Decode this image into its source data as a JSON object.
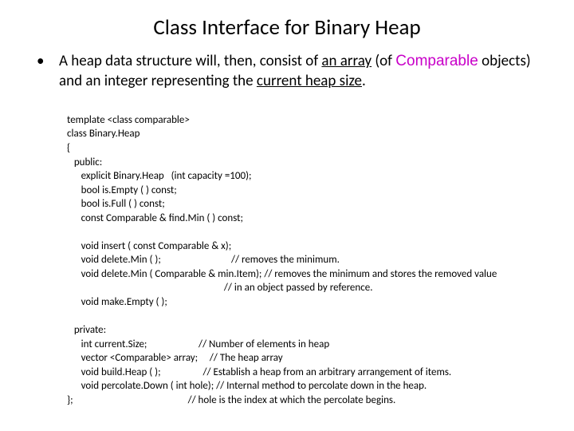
{
  "title": "Class Interface for Binary Heap",
  "bullet": {
    "dot": "•",
    "pre": "A heap data structure will, then, consist of ",
    "underlined1": "an array",
    "mid1": " (of ",
    "comparable": "Comparable",
    "mid2": " objects) and an integer representing the ",
    "underlined2": "current heap size",
    "post": "."
  },
  "code": {
    "l01": "template <class comparable>",
    "l02": "class Binary.Heap",
    "l03": "{",
    "l04": "   public:",
    "l05": "      explicit Binary.Heap   (int capacity =100);",
    "l06": "      bool is.Empty ( ) const;",
    "l07": "      bool is.Full ( ) const;",
    "l08": "      const Comparable & find.Min ( ) const;",
    "l09": "",
    "l10": "      void insert ( const Comparable & x);",
    "l11": "      void delete.Min ( );                              // removes the minimum.",
    "l12": "      void delete.Min ( Comparable & min.Item); // removes the minimum and stores the removed value",
    "l13": "                                                                   // in an object passed by reference.",
    "l14": "      void make.Empty ( );",
    "l15": "",
    "l16": "   private:",
    "l17": "      int current.Size;                      // Number of elements in heap",
    "l18": "      vector <Comparable> array;     // The heap array",
    "l19": "      void build.Heap ( );                  // Establish a heap from an arbitrary arrangement of items.",
    "l20": "      void percolate.Down ( int hole); // Internal method to percolate down in the heap.",
    "l21": "};                                                 // hole is the index at which the percolate begins."
  }
}
